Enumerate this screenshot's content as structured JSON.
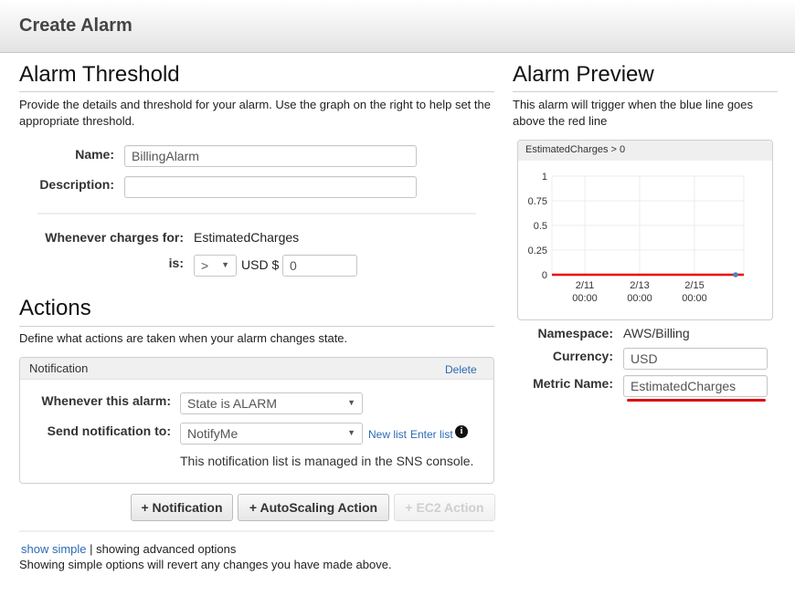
{
  "header": {
    "title": "Create Alarm"
  },
  "threshold": {
    "heading": "Alarm Threshold",
    "description": "Provide the details and threshold for your alarm. Use the graph on the right to help set the appropriate threshold.",
    "name_label": "Name:",
    "name_value": "BillingAlarm",
    "description_label": "Description:",
    "description_value": "",
    "whenever_label": "Whenever charges for:",
    "whenever_value": "EstimatedCharges",
    "is_label": "is:",
    "operator_value": ">",
    "currency_prefix": "USD $",
    "threshold_value": "0"
  },
  "actions": {
    "heading": "Actions",
    "description": "Define what actions are taken when your alarm changes state.",
    "notification": {
      "title": "Notification",
      "delete_label": "Delete",
      "whenever_label": "Whenever this alarm:",
      "state_value": "State is ALARM",
      "send_label": "Send notification to:",
      "topic_value": "NotifyMe",
      "new_list_label": "New list",
      "enter_list_label": "Enter list",
      "info_icon": "info-icon",
      "managed_text": "This notification list is managed in the SNS console."
    },
    "buttons": {
      "notification": "+ Notification",
      "autoscaling": "+ AutoScaling Action",
      "ec2": "+ EC2 Action"
    }
  },
  "footer": {
    "show_simple_label": "show simple",
    "separator": "|",
    "advanced_text": "showing advanced options",
    "warning_text": "Showing simple options will revert any changes you have made above."
  },
  "preview": {
    "heading": "Alarm Preview",
    "description": "This alarm will trigger when the blue line goes above the red line",
    "namespace_label": "Namespace:",
    "namespace_value": "AWS/Billing",
    "currency_label": "Currency:",
    "currency_value": "USD",
    "metric_label": "Metric Name:",
    "metric_value": "EstimatedCharges",
    "colors": {
      "metric_line": "#4a86c8",
      "threshold_line": "#ee0000",
      "underline": "#dd1111"
    }
  },
  "chart_data": {
    "type": "line",
    "title": "EstimatedCharges > 0",
    "xlabel": "",
    "ylabel": "",
    "ylim": [
      0,
      1
    ],
    "xlim_days": [
      9.8,
      16.8
    ],
    "y_ticks": [
      "0",
      "0.25",
      "0.5",
      "0.75",
      "1"
    ],
    "y_tick_values": [
      0,
      0.25,
      0.5,
      0.75,
      1
    ],
    "x_ticks": [
      {
        "day": 11,
        "date": "2/11",
        "time": "00:00"
      },
      {
        "day": 13,
        "date": "2/13",
        "time": "00:00"
      },
      {
        "day": 15,
        "date": "2/15",
        "time": "00:00"
      }
    ],
    "grid": true,
    "threshold": 0,
    "series": [
      {
        "name": "EstimatedCharges",
        "points": [
          {
            "day": 16.5,
            "value": 0
          }
        ]
      }
    ]
  }
}
